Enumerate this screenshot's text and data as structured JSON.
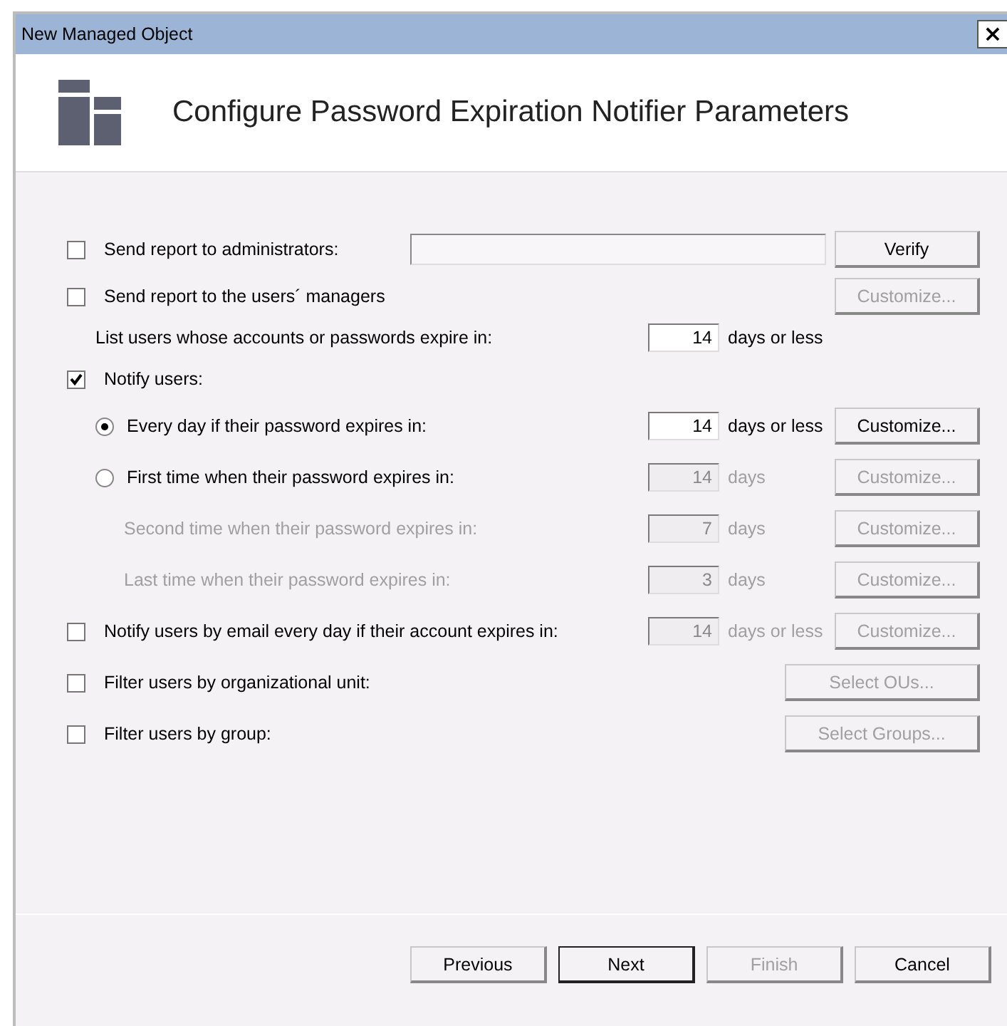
{
  "window": {
    "title": "New Managed Object",
    "close": "×"
  },
  "header": {
    "title": "Configure Password Expiration Notifier Parameters"
  },
  "options": [
    {
      "kind": "checkbox",
      "label": "Send report to administrators:",
      "checked": false,
      "disabled": false,
      "field": {
        "kind": "wide"
      },
      "button": {
        "label": "Verify",
        "disabled": false
      }
    },
    {
      "kind": "checkbox",
      "label": "Send report to the users´ managers",
      "checked": false,
      "disabled": false,
      "button": {
        "label": "Customize...",
        "disabled": true
      },
      "children": [
        {
          "kind": "note",
          "label": "List users whose accounts or passwords expire in:",
          "disabled": false,
          "field": {
            "kind": "number",
            "value": "14",
            "disabled": false
          },
          "suffix": "days or less"
        }
      ]
    },
    {
      "kind": "checkbox",
      "label": "Notify users:",
      "checked": true,
      "disabled": false,
      "children": [
        {
          "kind": "radio",
          "label": "Every day if their password expires in:",
          "selected": true,
          "disabled": false,
          "field": {
            "kind": "number",
            "value": "14",
            "disabled": false
          },
          "suffix": "days or less",
          "button": {
            "label": "Customize...",
            "disabled": false
          }
        },
        {
          "kind": "radio",
          "label": "First time when their password expires in:",
          "selected": false,
          "disabled": false,
          "field": {
            "kind": "number",
            "value": "14",
            "disabled": true
          },
          "suffix": "days",
          "button": {
            "label": "Customize...",
            "disabled": true
          },
          "children": [
            {
              "kind": "note",
              "label": "Second time when their password expires in:",
              "disabled": true,
              "field": {
                "kind": "number",
                "value": "7",
                "disabled": true
              },
              "suffix": "days",
              "button": {
                "label": "Customize...",
                "disabled": true
              }
            },
            {
              "kind": "note",
              "label": "Last time when their password expires in:",
              "disabled": true,
              "field": {
                "kind": "number",
                "value": "3",
                "disabled": true
              },
              "suffix": "days",
              "button": {
                "label": "Customize...",
                "disabled": true
              }
            }
          ]
        }
      ]
    },
    {
      "kind": "checkbox",
      "label": "Notify users by email every day if their account expires in:",
      "checked": false,
      "disabled": false,
      "field": {
        "kind": "number",
        "value": "14",
        "disabled": true
      },
      "suffix": "days or less",
      "button": {
        "label": "Customize...",
        "disabled": true
      }
    },
    {
      "kind": "checkbox",
      "label": "Filter users by organizational unit:",
      "checked": false,
      "disabled": false,
      "button": {
        "label": "Select OUs...",
        "disabled": true,
        "kind": "select"
      }
    },
    {
      "kind": "checkbox",
      "label": "Filter users by group:",
      "checked": false,
      "disabled": false,
      "button": {
        "label": "Select Groups...",
        "disabled": true,
        "kind": "select"
      }
    }
  ],
  "footer_buttons": [
    {
      "label": "Previous",
      "disabled": false,
      "default": false
    },
    {
      "label": "Next",
      "disabled": false,
      "default": true
    },
    {
      "label": "Finish",
      "disabled": true,
      "default": false
    },
    {
      "label": "Cancel",
      "disabled": false,
      "default": false
    }
  ]
}
